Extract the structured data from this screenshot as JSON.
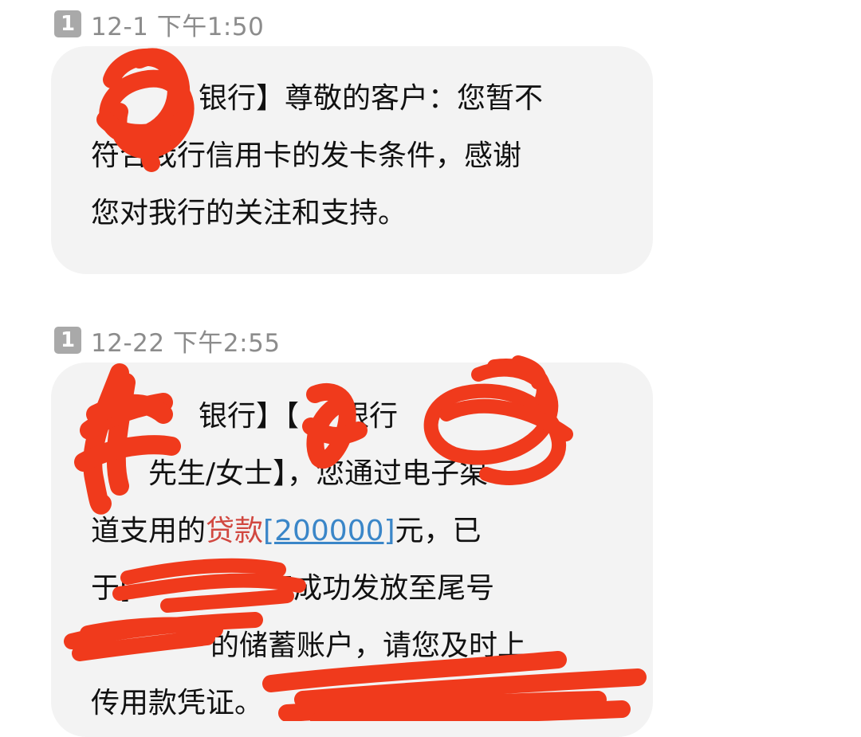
{
  "messages": [
    {
      "sim": "1",
      "timestamp": "12-1 下午1:50",
      "lines": [
        {
          "a": "银行】尊敬的客户：您暂不"
        },
        {
          "a": "符合我行信用卡的发卡条件，感谢"
        },
        {
          "a": "您对我行的关注和支持。"
        }
      ]
    },
    {
      "sim": "1",
      "timestamp": "12-22 下午2:55",
      "lines": [
        {
          "a": "银行】【",
          "b": "银行"
        },
        {
          "a": "先生/女士】，您通过电子渠"
        },
        {
          "a": "道支用的",
          "loan": "贷款",
          "amount": "[200000]",
          "b": "元，已"
        },
        {
          "a": "于[",
          "b": "]成功发放至尾号"
        },
        {
          "a": "的储蓄账户，请您及时上"
        },
        {
          "a": "传用款凭证。"
        }
      ]
    }
  ],
  "colors": {
    "bubble_bg": "#f3f3f3",
    "timestamp": "#8c8c8c",
    "sim_badge": "#a9a9a9",
    "loan_keyword": "#d14840",
    "link": "#3a86c8",
    "redaction": "#f03a1c"
  }
}
